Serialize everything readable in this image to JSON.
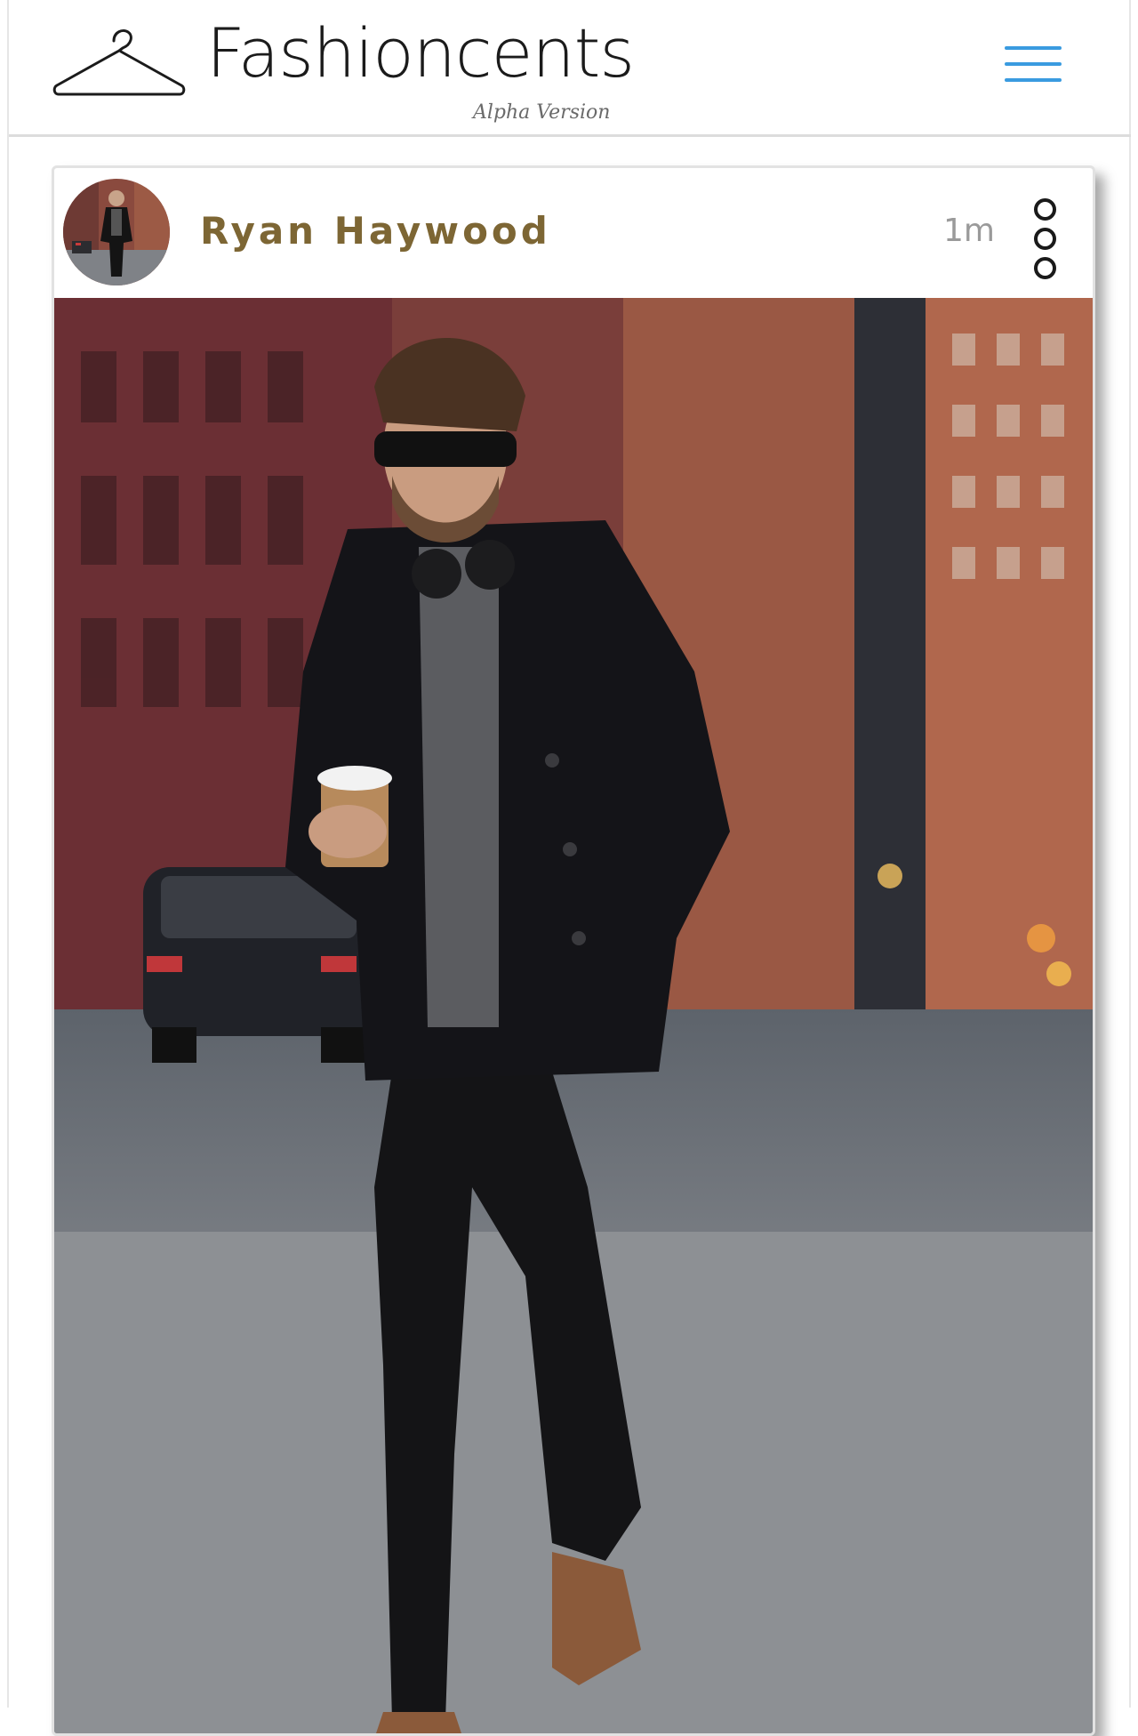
{
  "header": {
    "brand_title": "Fashioncents",
    "brand_subtitle": "Alpha Version",
    "logo_icon": "hanger-icon",
    "menu_icon": "hamburger-menu-icon",
    "menu_color": "#3a9be0"
  },
  "post": {
    "username": "Ryan Haywood",
    "timestamp": "1m",
    "options_icon": "more-options-icon",
    "username_color": "#7d6634"
  }
}
